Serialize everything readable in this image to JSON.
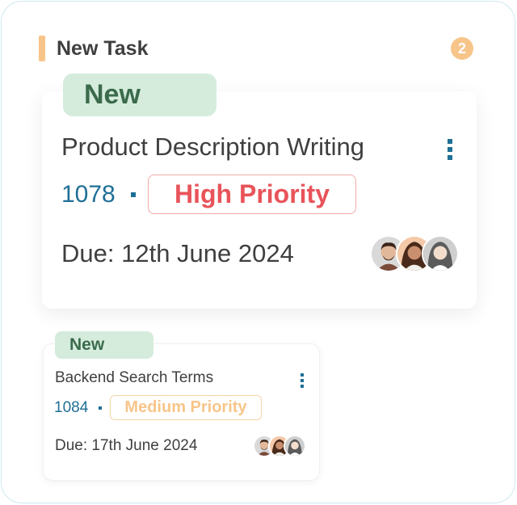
{
  "column": {
    "title": "New Task",
    "count": "2",
    "accent_color": "#f7c58a"
  },
  "cards": [
    {
      "status": "New",
      "title": "Product Description Writing",
      "id": "1078",
      "priority": "High Priority",
      "priority_color": "#e8545a",
      "due": "Due: 12th June 2024",
      "menu_icon": "kebab-menu-icon",
      "assignees": [
        "avatar-man",
        "avatar-woman-dark",
        "avatar-woman-light"
      ]
    },
    {
      "status": "New",
      "title": "Backend Search Terms",
      "id": "1084",
      "priority": "Medium Priority",
      "priority_color": "#f7c58a",
      "due": "Due: 17th June 2024",
      "menu_icon": "kebab-menu-icon",
      "assignees": [
        "avatar-man",
        "avatar-woman-dark",
        "avatar-woman-light"
      ]
    }
  ],
  "colors": {
    "status_bg": "#d5ecdd",
    "status_text": "#3b6b4c",
    "id_color": "#1f6f96",
    "text": "#3f3f3f"
  }
}
